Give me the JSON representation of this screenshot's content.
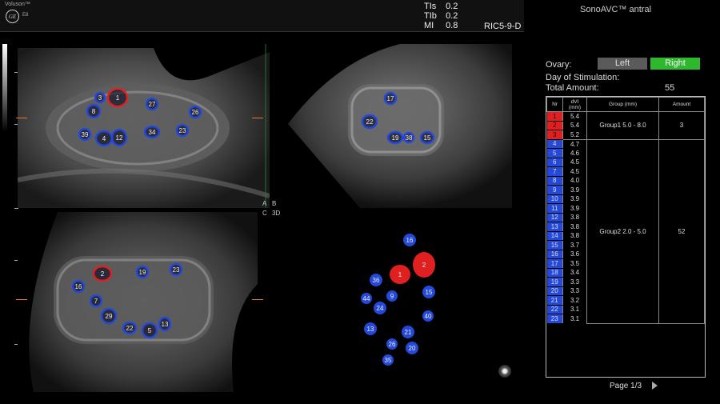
{
  "header": {
    "brand": "Voluson™",
    "logo_text": "GE",
    "probe_model": "E8",
    "probe_code": "RIC5-9-D",
    "indices": [
      {
        "key": "TIs",
        "value": "0.2"
      },
      {
        "key": "TIb",
        "value": "0.2"
      },
      {
        "key": "MI",
        "value": "0.8"
      }
    ]
  },
  "quadrant_labels": {
    "a": "A",
    "b": "B",
    "c": "C",
    "d": "3D"
  },
  "panel": {
    "title": "SonoAVC™ antral",
    "ovary_label": "Ovary:",
    "left_button": "Left",
    "right_button": "Right",
    "selected": "Right",
    "stimulation_label": "Day of Stimulation:",
    "total_label": "Total Amount:",
    "total_value": "55",
    "page_label": "Page 1/3"
  },
  "table": {
    "headers": {
      "nr": "Nr",
      "dvi": "dVI\n(mm)",
      "group": "Group (mm)",
      "amount": "Amount"
    },
    "group1": {
      "label": "Group1 5.0 - 8.0",
      "amount": "3",
      "color": "#e02020",
      "rows": [
        {
          "nr": "1",
          "dvi": "5.4"
        },
        {
          "nr": "2",
          "dvi": "5.4"
        },
        {
          "nr": "3",
          "dvi": "5.2"
        }
      ]
    },
    "group2": {
      "label": "Group2 2.0 - 5.0",
      "amount": "52",
      "color": "#2448d8",
      "rows": [
        {
          "nr": "4",
          "dvi": "4.7"
        },
        {
          "nr": "5",
          "dvi": "4.6"
        },
        {
          "nr": "6",
          "dvi": "4.5"
        },
        {
          "nr": "7",
          "dvi": "4.5"
        },
        {
          "nr": "8",
          "dvi": "4.0"
        },
        {
          "nr": "9",
          "dvi": "3.9"
        },
        {
          "nr": "10",
          "dvi": "3.9"
        },
        {
          "nr": "11",
          "dvi": "3.9"
        },
        {
          "nr": "12",
          "dvi": "3.8"
        },
        {
          "nr": "13",
          "dvi": "3.8"
        },
        {
          "nr": "14",
          "dvi": "3.8"
        },
        {
          "nr": "15",
          "dvi": "3.7"
        },
        {
          "nr": "16",
          "dvi": "3.6"
        },
        {
          "nr": "17",
          "dvi": "3.5"
        },
        {
          "nr": "18",
          "dvi": "3.4"
        },
        {
          "nr": "19",
          "dvi": "3.3"
        },
        {
          "nr": "20",
          "dvi": "3.3"
        },
        {
          "nr": "21",
          "dvi": "3.2"
        },
        {
          "nr": "22",
          "dvi": "3.1"
        },
        {
          "nr": "23",
          "dvi": "3.1"
        }
      ]
    }
  },
  "follicle_labels": {
    "paneA_red": [
      "1"
    ],
    "paneA_blue": [
      "3",
      "8",
      "4",
      "12",
      "39",
      "34",
      "27",
      "26",
      "23"
    ],
    "paneB_blue": [
      "17",
      "22",
      "19",
      "38",
      "15"
    ],
    "paneC_red": [
      "2"
    ],
    "paneC_blue": [
      "16",
      "7",
      "29",
      "22",
      "5",
      "13",
      "19",
      "23"
    ],
    "paneD_red": [
      "1",
      "2"
    ],
    "paneD_blue": [
      "16",
      "36",
      "44",
      "24",
      "9",
      "13",
      "40",
      "15",
      "26",
      "21",
      "20",
      "35"
    ]
  },
  "colors": {
    "follicle_red": "#e02020",
    "follicle_blue": "#2448d8",
    "ovary_right_active": "#2eb82e",
    "ovary_left_inactive": "#5a5a5a"
  }
}
